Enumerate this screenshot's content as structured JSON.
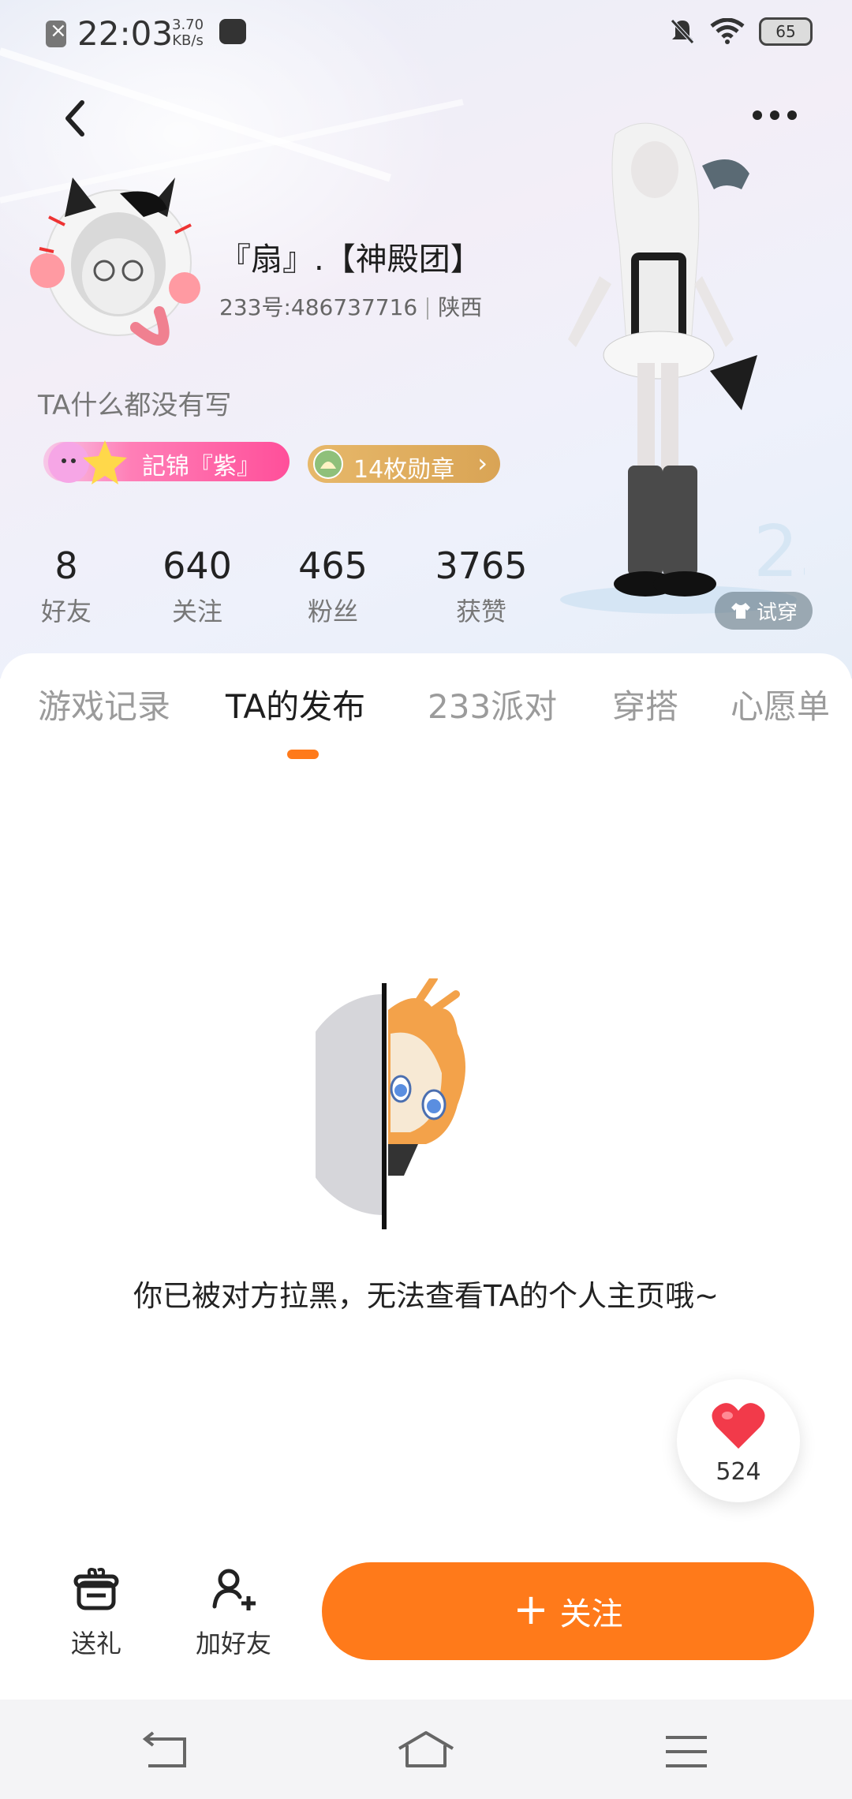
{
  "status_bar": {
    "time": "22:03",
    "speed_value": "3.70",
    "speed_unit": "KB/s",
    "battery": "65"
  },
  "profile": {
    "nickname": "『扇』.【神殿团】",
    "id_text": "233号:486737716",
    "region": "陕西",
    "bio": "TA什么都没有写",
    "title_badge": "記锦『紫』",
    "medal_badge": "14枚勋章",
    "try_on_label": "试穿"
  },
  "stats": [
    {
      "value": "8",
      "label": "好友"
    },
    {
      "value": "640",
      "label": "关注"
    },
    {
      "value": "465",
      "label": "粉丝"
    },
    {
      "value": "3765",
      "label": "获赞"
    }
  ],
  "tabs": [
    {
      "label": "游戏记录",
      "active": false
    },
    {
      "label": "TA的发布",
      "active": true
    },
    {
      "label": "233派对",
      "active": false
    },
    {
      "label": "穿搭",
      "active": false
    },
    {
      "label": "心愿单",
      "active": false
    }
  ],
  "blocked_message": "你已被对方拉黑，无法查看TA的个人主页哦~",
  "like": {
    "count": "524"
  },
  "actions": {
    "gift_label": "送礼",
    "add_friend_label": "加好友",
    "follow_label": "关注",
    "follow_plus": "+"
  },
  "colors": {
    "accent": "#ff7a1a",
    "like_red": "#f23a4a",
    "badge_pink": "#ff4f9a",
    "badge_gold": "#d9a455"
  },
  "icons": [
    "back-icon",
    "more-icon",
    "heart-icon",
    "gift-icon",
    "add-friend-icon",
    "nav-back-icon",
    "nav-home-icon",
    "nav-menu-icon",
    "wifi-icon",
    "mute-icon"
  ]
}
